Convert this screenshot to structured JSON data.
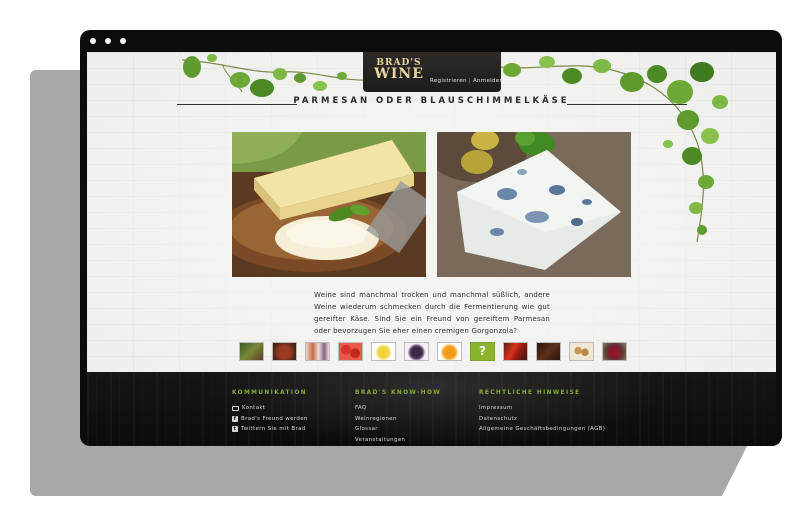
{
  "brand": {
    "line1": "BRAD'S",
    "line2": "WINE"
  },
  "auth": {
    "register": "Registrieren",
    "separator": "|",
    "login": "Anmelden"
  },
  "page_title": "PARMESAN ODER BLAUSCHIMMELKÄSE",
  "photos": [
    {
      "icon": "parmesan-photo"
    },
    {
      "icon": "gorgonzola-photo"
    }
  ],
  "description": "Weine sind manchmal trocken und manchmal süßlich, andere Weine wiederum schmecken durch die Fermentierung wie gut gereifter Käse. Sind Sie ein Freund von gereiftem Parmesan oder bevorzugen Sie eher einen cremigen Gorgonzola?",
  "thumbnails": [
    {
      "icon": "herb-thumbnail"
    },
    {
      "icon": "meat-thumbnail"
    },
    {
      "icon": "people-thumbnail"
    },
    {
      "icon": "berries-thumbnail"
    },
    {
      "icon": "lemon-thumbnail"
    },
    {
      "icon": "plum-thumbnail"
    },
    {
      "icon": "orange-thumbnail"
    },
    {
      "icon": "question-thumbnail",
      "label": "?"
    },
    {
      "icon": "chili-thumbnail"
    },
    {
      "icon": "chocolate-thumbnail"
    },
    {
      "icon": "nuts-thumbnail"
    },
    {
      "icon": "cherry-thumbnail"
    }
  ],
  "footer": {
    "kommunikation": {
      "heading": "KOMMUNIKATION",
      "items": [
        "Kontakt",
        "Brad's Freund werden",
        "Twittern Sie mit Brad"
      ],
      "icons": [
        "mail-icon",
        "facebook-icon",
        "twitter-icon"
      ]
    },
    "knowhow": {
      "heading": "BRAD'S KNOW-HOW",
      "items": [
        "FAQ",
        "Weinregionen",
        "Glossar",
        "Veranstaltungen"
      ]
    },
    "rechtliches": {
      "heading": "RECHTLICHE HINWEISE",
      "items": [
        "Impressum",
        "Datenschutz",
        "Allgemeine Geschäftsbedingungen (AGB)"
      ]
    }
  },
  "colors": {
    "accent_green": "#8aa83a",
    "footer_bg": "#121212",
    "logo_gold": "#e7d7a0"
  }
}
